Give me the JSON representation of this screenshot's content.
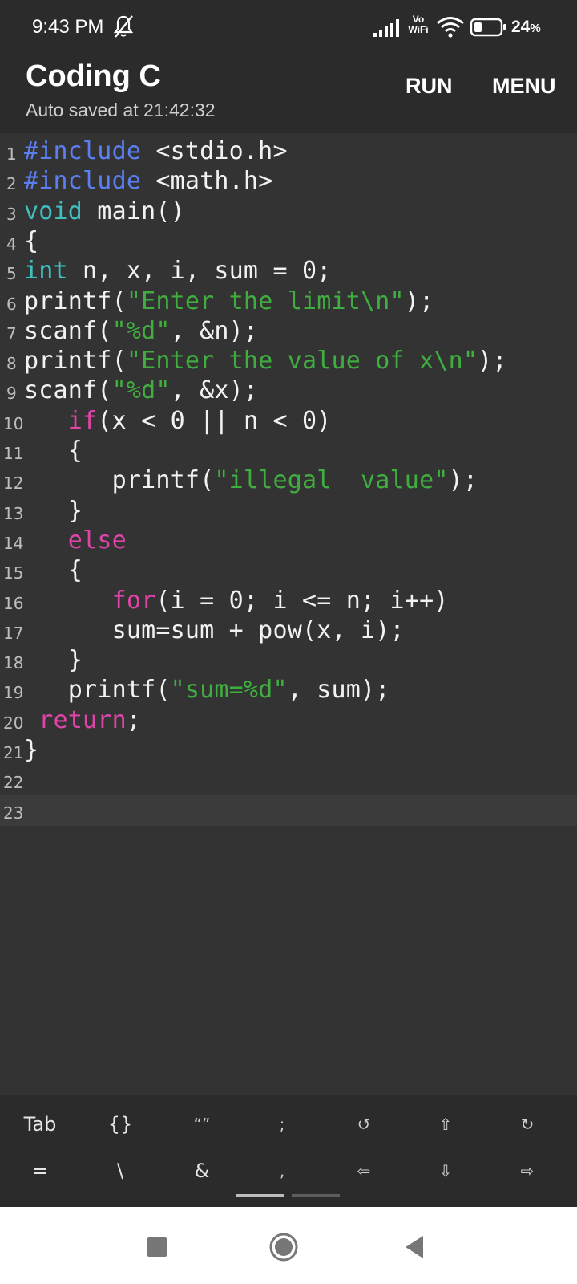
{
  "status_bar": {
    "time": "9:43 PM",
    "network_label_top": "Vo",
    "network_label_bottom": "WiFi",
    "battery_percent": "24",
    "battery_percent_sign": "%",
    "icons": [
      "bell-off-icon",
      "signal-icon",
      "wifi-icon",
      "battery-icon"
    ]
  },
  "app_bar": {
    "title": "Coding C",
    "subtitle": "Auto saved at 21:42:32",
    "run_label": "RUN",
    "menu_label": "MENU"
  },
  "editor": {
    "current_line": 23,
    "lines": [
      {
        "number": "1",
        "tokens": [
          {
            "t": "#include",
            "c": "pp"
          },
          {
            "t": " <stdio.h>",
            "c": ""
          }
        ]
      },
      {
        "number": "2",
        "tokens": [
          {
            "t": "#include",
            "c": "pp"
          },
          {
            "t": " <math.h>",
            "c": ""
          }
        ]
      },
      {
        "number": "3",
        "tokens": [
          {
            "t": "void",
            "c": "kw"
          },
          {
            "t": " main()",
            "c": ""
          }
        ]
      },
      {
        "number": "4",
        "tokens": [
          {
            "t": "{",
            "c": ""
          }
        ]
      },
      {
        "number": "5",
        "tokens": [
          {
            "t": "int",
            "c": "kw"
          },
          {
            "t": " n, x, i, sum = 0;",
            "c": ""
          }
        ]
      },
      {
        "number": "6",
        "tokens": [
          {
            "t": "printf(",
            "c": ""
          },
          {
            "t": "\"Enter the limit\\n\"",
            "c": "str"
          },
          {
            "t": ");",
            "c": ""
          }
        ]
      },
      {
        "number": "7",
        "tokens": [
          {
            "t": "scanf(",
            "c": ""
          },
          {
            "t": "\"%d\"",
            "c": "str"
          },
          {
            "t": ", &n);",
            "c": ""
          }
        ]
      },
      {
        "number": "8",
        "tokens": [
          {
            "t": "printf(",
            "c": ""
          },
          {
            "t": "\"Enter the value of x\\n\"",
            "c": "str"
          },
          {
            "t": ");",
            "c": ""
          }
        ]
      },
      {
        "number": "9",
        "tokens": [
          {
            "t": "scanf(",
            "c": ""
          },
          {
            "t": "\"%d\"",
            "c": "str"
          },
          {
            "t": ", &x);",
            "c": ""
          }
        ]
      },
      {
        "number": "10",
        "tokens": [
          {
            "t": "   ",
            "c": ""
          },
          {
            "t": "if",
            "c": "ctl"
          },
          {
            "t": "(x < 0 || n < 0)",
            "c": ""
          }
        ]
      },
      {
        "number": "11",
        "tokens": [
          {
            "t": "   {",
            "c": ""
          }
        ]
      },
      {
        "number": "12",
        "tokens": [
          {
            "t": "      printf(",
            "c": ""
          },
          {
            "t": "\"illegal  value\"",
            "c": "str"
          },
          {
            "t": ");",
            "c": ""
          }
        ]
      },
      {
        "number": "13",
        "tokens": [
          {
            "t": "   }",
            "c": ""
          }
        ]
      },
      {
        "number": "14",
        "tokens": [
          {
            "t": "   ",
            "c": ""
          },
          {
            "t": "else",
            "c": "ctl"
          }
        ]
      },
      {
        "number": "15",
        "tokens": [
          {
            "t": "   {",
            "c": ""
          }
        ]
      },
      {
        "number": "16",
        "tokens": [
          {
            "t": "      ",
            "c": ""
          },
          {
            "t": "for",
            "c": "ctl"
          },
          {
            "t": "(i = 0; i <= n; i++)",
            "c": ""
          }
        ]
      },
      {
        "number": "17",
        "tokens": [
          {
            "t": "      sum=sum + pow(x, i);",
            "c": ""
          }
        ]
      },
      {
        "number": "18",
        "tokens": [
          {
            "t": "   }",
            "c": ""
          }
        ]
      },
      {
        "number": "19",
        "tokens": [
          {
            "t": "   printf(",
            "c": ""
          },
          {
            "t": "\"sum=%d\"",
            "c": "str"
          },
          {
            "t": ", sum);",
            "c": ""
          }
        ]
      },
      {
        "number": "20",
        "tokens": [
          {
            "t": " ",
            "c": ""
          },
          {
            "t": "return",
            "c": "ctl"
          },
          {
            "t": ";",
            "c": ""
          }
        ]
      },
      {
        "number": "21",
        "tokens": [
          {
            "t": "}",
            "c": ""
          }
        ]
      },
      {
        "number": "22",
        "tokens": []
      },
      {
        "number": "23",
        "tokens": []
      }
    ]
  },
  "extra_keys": {
    "row1": [
      {
        "label": "Tab",
        "name": "key-tab"
      },
      {
        "label": "{}",
        "name": "key-braces"
      },
      {
        "label": "“”",
        "name": "key-quotes"
      },
      {
        "label": ";",
        "name": "key-semicolon"
      },
      {
        "label": "↺",
        "name": "key-undo"
      },
      {
        "label": "⇧",
        "name": "key-arrow-up"
      },
      {
        "label": "↻",
        "name": "key-redo"
      }
    ],
    "row2": [
      {
        "label": "=",
        "name": "key-equals"
      },
      {
        "label": "\\",
        "name": "key-backslash"
      },
      {
        "label": "&",
        "name": "key-ampersand"
      },
      {
        "label": ",",
        "name": "key-comma"
      },
      {
        "label": "⇦",
        "name": "key-arrow-left"
      },
      {
        "label": "⇩",
        "name": "key-arrow-down"
      },
      {
        "label": "⇨",
        "name": "key-arrow-right"
      }
    ]
  },
  "nav_bar": {
    "icons": [
      "recents-square-icon",
      "home-circle-icon",
      "back-triangle-icon"
    ]
  },
  "colors": {
    "preprocessor": "#5b7ff0",
    "type_keyword": "#3fbfbf",
    "control_keyword": "#e044a8",
    "string": "#3fae3f",
    "editor_bg": "#333333",
    "bar_bg": "#2b2b2b"
  }
}
